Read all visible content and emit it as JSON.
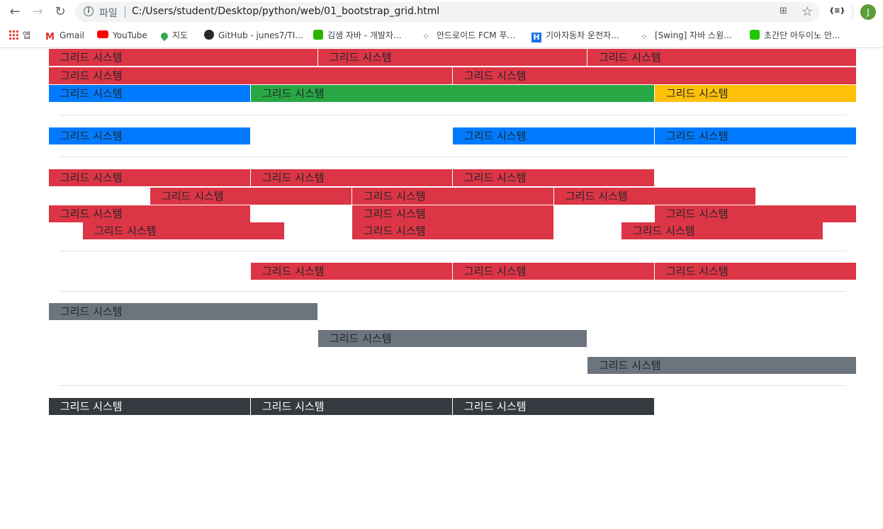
{
  "browser": {
    "scheme_label": "파일",
    "url": "C:/Users/student/Desktop/python/web/01_bootstrap_grid.html",
    "avatar_letter": "J",
    "ext_label": "{≡}"
  },
  "bookmarks": [
    {
      "label": "앱",
      "icon": "apps-grid-icon",
      "color": "#4285f4"
    },
    {
      "label": "Gmail",
      "icon": "gmail-icon",
      "color": "#d93025"
    },
    {
      "label": "YouTube",
      "icon": "youtube-icon",
      "color": "#ff0000"
    },
    {
      "label": "지도",
      "icon": "maps-pin-icon",
      "color": "#34a853"
    },
    {
      "label": "GitHub - junes7/TI...",
      "icon": "github-icon",
      "color": "#24292e"
    },
    {
      "label": "김샘 자바 - 개발자...",
      "icon": "blog-icon",
      "color": "#2db400"
    },
    {
      "label": "안드로이드 FCM 푸...",
      "icon": "dots-icon",
      "color": "#333333"
    },
    {
      "label": "기아자동차 운전자...",
      "icon": "h-icon",
      "color": "#1a73e8"
    },
    {
      "label": "[Swing] 자바 스윙...",
      "icon": "dots-icon",
      "color": "#333333"
    },
    {
      "label": "초간단 아두이노 안...",
      "icon": "kakao-icon",
      "color": "#1ec800"
    }
  ],
  "grid": {
    "cell_text": "그리드 시스템",
    "colors": {
      "danger": "#dc3545",
      "primary": "#007bff",
      "success": "#28a745",
      "warning": "#ffc107",
      "secondary": "#6c757d",
      "dark": "#343a40"
    }
  }
}
